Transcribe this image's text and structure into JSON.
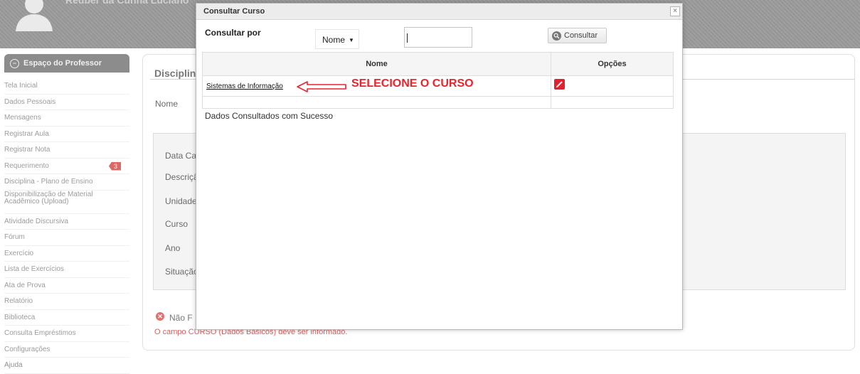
{
  "header": {
    "user_name": "Reuber da Cunha Luciano"
  },
  "sidebar": {
    "title": "Espaço do Professor",
    "items": [
      {
        "label": "Tela Inicial"
      },
      {
        "label": "Dados Pessoais"
      },
      {
        "label": "Mensagens"
      },
      {
        "label": "Registrar Aula"
      },
      {
        "label": "Registrar Nota"
      },
      {
        "label": "Requerimento",
        "badge": "3"
      },
      {
        "label": "Disciplina - Plano de Ensino"
      },
      {
        "label": "Disponibilização de Material Acadêmico (Upload)"
      },
      {
        "label": "Atividade Discursiva"
      },
      {
        "label": "Fórum"
      },
      {
        "label": "Exercício"
      },
      {
        "label": "Lista de Exercícios"
      },
      {
        "label": "Ata de Prova"
      },
      {
        "label": "Relatório"
      },
      {
        "label": "Biblioteca"
      },
      {
        "label": "Consulta Empréstimos"
      },
      {
        "label": "Configurações"
      },
      {
        "label": "Ajuda"
      }
    ]
  },
  "main": {
    "title": "Disciplin",
    "nome_label": "Nome",
    "fields": [
      "Data Cad",
      "Descriçã",
      "Unidade",
      "Curso",
      "Ano",
      "Situação"
    ],
    "error_title": "Não F",
    "error_message": "O campo CURSO (Dados Básicos) deve ser informado."
  },
  "modal": {
    "title": "Consultar Curso",
    "close_symbol": "×",
    "search_label": "Consultar por",
    "select_value": "Nome",
    "input_value": "",
    "consult_button": "Consultar",
    "table": {
      "headers": [
        "Nome",
        "Opções"
      ],
      "rows": [
        {
          "nome": "Sistemas de Informação"
        }
      ]
    },
    "status_message": "Dados Consultados com Sucesso",
    "annotation": "SELECIONE O CURSO"
  },
  "colors": {
    "accent_red": "#e5202e",
    "header_gray": "#8c8c8c"
  }
}
